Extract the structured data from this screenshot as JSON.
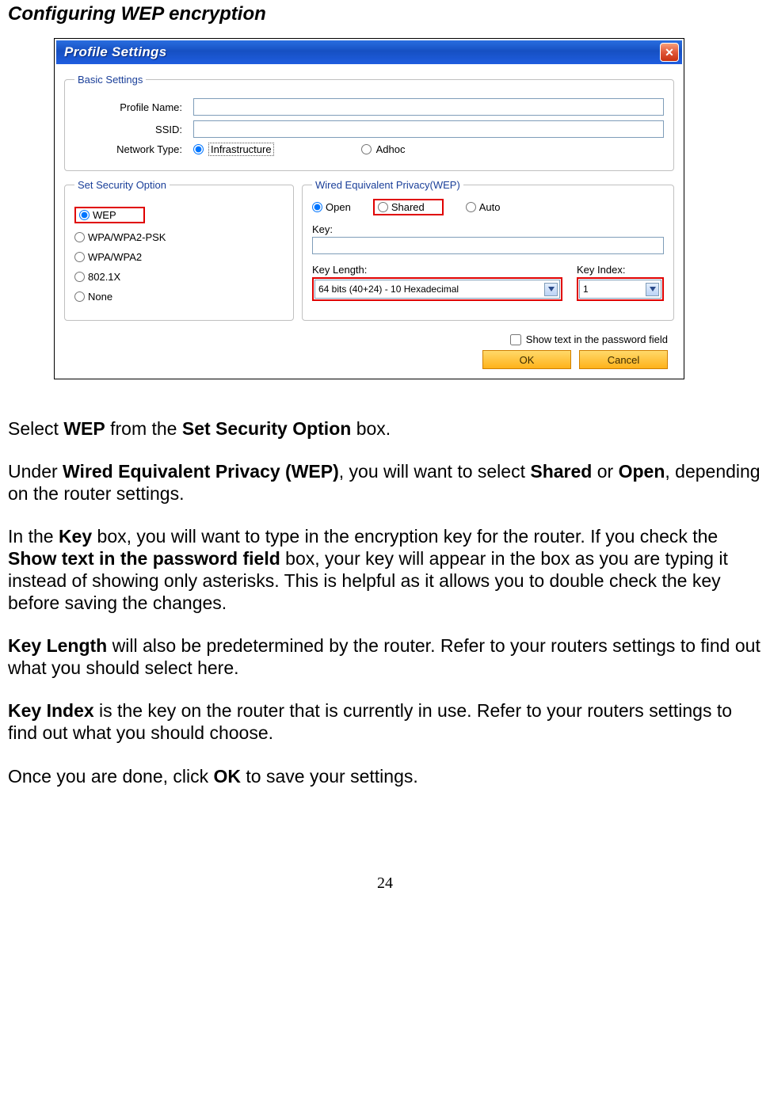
{
  "heading": "Configuring WEP encryption",
  "window": {
    "title": "Profile Settings",
    "close": "✕",
    "basic": {
      "legend": "Basic Settings",
      "profile_label": "Profile Name:",
      "profile_value": "",
      "ssid_label": "SSID:",
      "ssid_value": "",
      "nettype_label": "Network Type:",
      "infra": "Infrastructure",
      "adhoc": "Adhoc"
    },
    "security": {
      "legend": "Set Security Option",
      "wep": "WEP",
      "wpapsk": "WPA/WPA2-PSK",
      "wpa": "WPA/WPA2",
      "x8021": "802.1X",
      "none": "None"
    },
    "wep": {
      "legend": "Wired Equivalent Privacy(WEP)",
      "open": "Open",
      "shared": "Shared",
      "auto": "Auto",
      "key_label": "Key:",
      "key_value": "",
      "keylen_label": "Key Length:",
      "keylen_value": "64 bits (40+24) - 10 Hexadecimal",
      "keyidx_label": "Key Index:",
      "keyidx_value": "1"
    },
    "showtext": "Show text in the password field",
    "ok": "OK",
    "cancel": "Cancel"
  },
  "para": {
    "p1a": "Select ",
    "p1b": "WEP",
    "p1c": " from the ",
    "p1d": "Set Security Option",
    "p1e": " box.",
    "p2a": "Under ",
    "p2b": "Wired Equivalent Privacy (WEP)",
    "p2c": ", you will want to select ",
    "p2d": "Shared",
    "p2e": " or ",
    "p2f": "Open",
    "p2g": ", depending on the router settings.",
    "p3a": "In the ",
    "p3b": "Key",
    "p3c": " box, you will want to type in the encryption key for the router.  If you check the ",
    "p3d": "Show text in the password field",
    "p3e": " box, your key will appear in the box as you are typing it instead of showing only asterisks.  This is helpful as it allows you to double check the key before saving the changes.",
    "p4a": "Key Length",
    "p4b": " will also be predetermined by the router.  Refer to your routers settings to find out what you should select here.",
    "p5a": "Key Index",
    "p5b": " is the key on the router that is currently in use.  Refer to your routers settings to find out what you should choose.",
    "p6a": "Once you are done, click ",
    "p6b": "OK",
    "p6c": " to save your settings."
  },
  "pagenum": "24"
}
